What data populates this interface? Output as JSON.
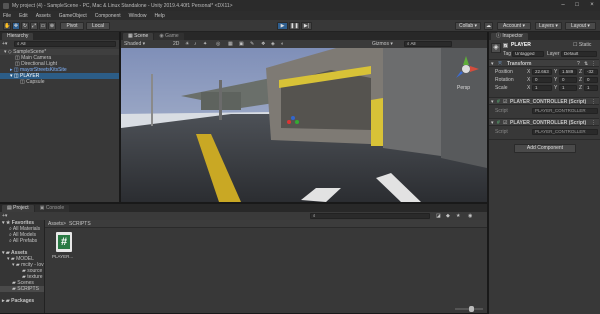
{
  "window": {
    "title": "My project (4) - SampleScene - PC, Mac & Linux Standalone - Unity 2019.4.40f1 Personal* <DX11>"
  },
  "menu": [
    "File",
    "Edit",
    "Assets",
    "GameObject",
    "Component",
    "Window",
    "Help"
  ],
  "toolbar": {
    "pivot": "Pivot",
    "local": "Local",
    "collab": "Collab",
    "account": "Account",
    "layers": "Layers",
    "layout": "Layout"
  },
  "hierarchy": {
    "tab": "Hierarchy",
    "items": [
      "SampleScene*",
      "Main Camera",
      "Directional Light",
      "mayorStreetsKitsSite",
      "PLAYER",
      "Capsule"
    ]
  },
  "scene": {
    "tab_scene": "Scene",
    "tab_game": "Game",
    "shading": "Shaded",
    "mode2d": "2D",
    "gizmos": "Gizmos",
    "search_placeholder": "All",
    "persp": "Persp"
  },
  "inspector": {
    "tab": "Inspector",
    "object_name": "PLAYER",
    "static_label": "Static",
    "tag_label": "Tag",
    "tag_value": "Untagged",
    "layer_label": "Layer",
    "layer_value": "Default",
    "transform_title": "Transform",
    "position_label": "Position",
    "rotation_label": "Rotation",
    "scale_label": "Scale",
    "position": {
      "x": "22.663",
      "y": "1.589",
      "z": "-32"
    },
    "rotation": {
      "x": "0",
      "y": "0",
      "z": "0"
    },
    "scale": {
      "x": "1",
      "y": "1",
      "z": "1"
    },
    "comp1_title": "PLAYER_CONTROLLER (Script)",
    "comp1_script_label": "Script",
    "comp1_script_value": "PLAYER_CONTROLLER",
    "comp2_title": "PLAYER_CONTROLLER (Script)",
    "comp2_script_label": "Script",
    "comp2_script_value": "PLAYER_CONTROLLER",
    "add_component": "Add Component"
  },
  "project": {
    "tab_project": "Project",
    "tab_console": "Console",
    "favorites": "Favorites",
    "fav_items": [
      "All Materials",
      "All Models",
      "All Prefabs"
    ],
    "assets": "Assets",
    "asset_items": [
      "MODEL",
      "mcity - lov",
      "source",
      "texture",
      "Scenes",
      "SCRIPTS"
    ],
    "packages": "Packages",
    "breadcrumb_root": "Assets",
    "breadcrumb_sep": ">",
    "breadcrumb_current": "SCRIPTS",
    "file_name": "PLAYER...",
    "file_icon_glyph": "#"
  },
  "colors": {
    "selection": "#2c5d87",
    "script_icon": "#2a7a44",
    "play_active": "#3b73b4"
  }
}
